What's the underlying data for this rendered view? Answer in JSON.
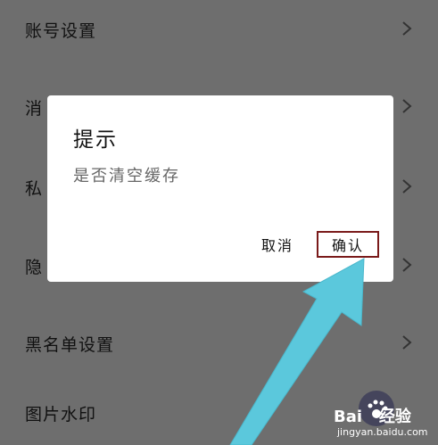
{
  "settings": {
    "items": [
      {
        "label": "账号设置"
      },
      {
        "label": "消"
      },
      {
        "label": "私"
      },
      {
        "label": "隐"
      },
      {
        "label": "黑名单设置"
      },
      {
        "label": "图片水印"
      }
    ]
  },
  "dialog": {
    "title": "提示",
    "message": "是否清空缓存",
    "cancel_label": "取消",
    "confirm_label": "确认"
  },
  "watermark": {
    "brand": "Bai",
    "brand_suffix": "经验",
    "url": "jingyan.baidu.com"
  },
  "colors": {
    "background_dimmed": "#6e6e6e",
    "dialog_bg": "#ffffff",
    "highlight_border": "#7a1a1a",
    "arrow": "#5bc8dc"
  },
  "icons": [
    "chevron-right-icon",
    "annotation-arrow-icon",
    "paw-icon"
  ]
}
